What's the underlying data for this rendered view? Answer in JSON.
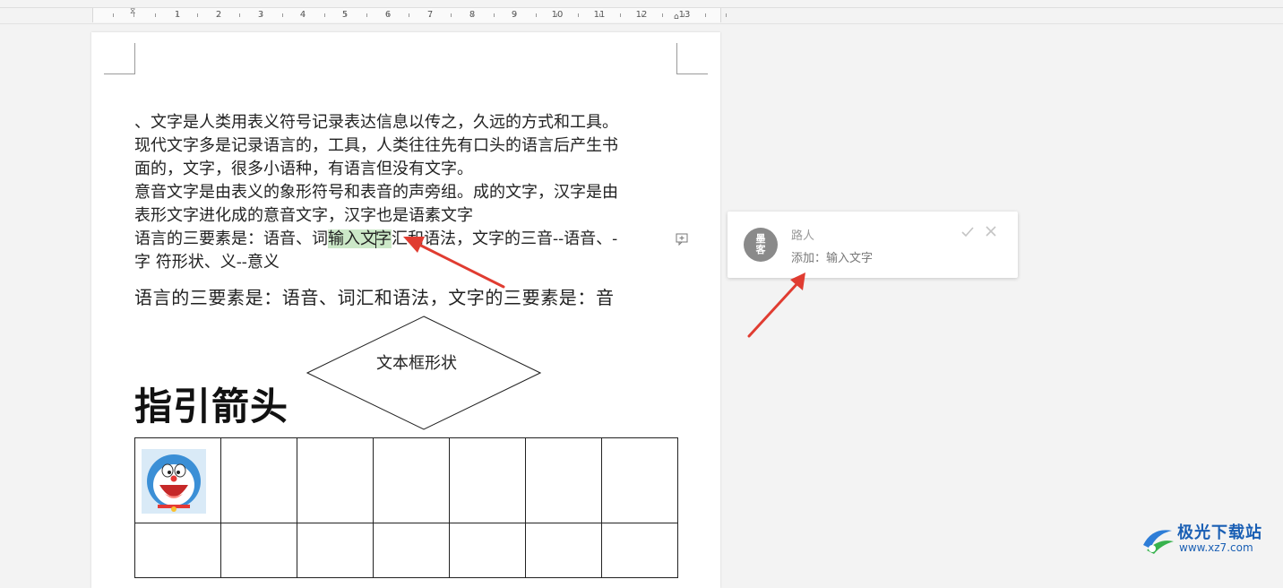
{
  "ruler": {
    "numbers": [
      "1",
      "2",
      "3",
      "4",
      "5",
      "6",
      "7",
      "8",
      "9",
      "10",
      "11",
      "12",
      "13"
    ]
  },
  "document": {
    "paragraphs": [
      "、文字是人类用表义符号记录表达信息以传之，久远的方式和工具。",
      "现代文字多是记录语言的，工具，人类往往先有口头的语言后产生书",
      "面的，文字，很多小语种，有语言但没有文字。",
      "意音文字是由表义的象形符号和表音的声旁组。成的文字，汉字是由",
      "表形文字进化成的意音文字，汉字也是语素文字"
    ],
    "line6_before": "语言的三要素是：语音、词",
    "line6_highlight_a": "输入文",
    "line6_highlight_b": "字",
    "line6_after": "汇和语法，文字的三音--语音、-",
    "line7": "字  符形状、义--意义",
    "line8": "语言的三要素是：语音、词汇和语法，文字的三要素是：音",
    "diamond_label": "文本框形状",
    "heading": "指引箭头"
  },
  "comment": {
    "avatar_text": "墨客",
    "author": "路人",
    "text": "添加：输入文字"
  },
  "watermark": {
    "name": "极光下载站",
    "url": "www.xz7.com"
  },
  "colors": {
    "highlight": "#cce8c8",
    "arrow": "#e03c31",
    "brand": "#1a5fb4"
  }
}
